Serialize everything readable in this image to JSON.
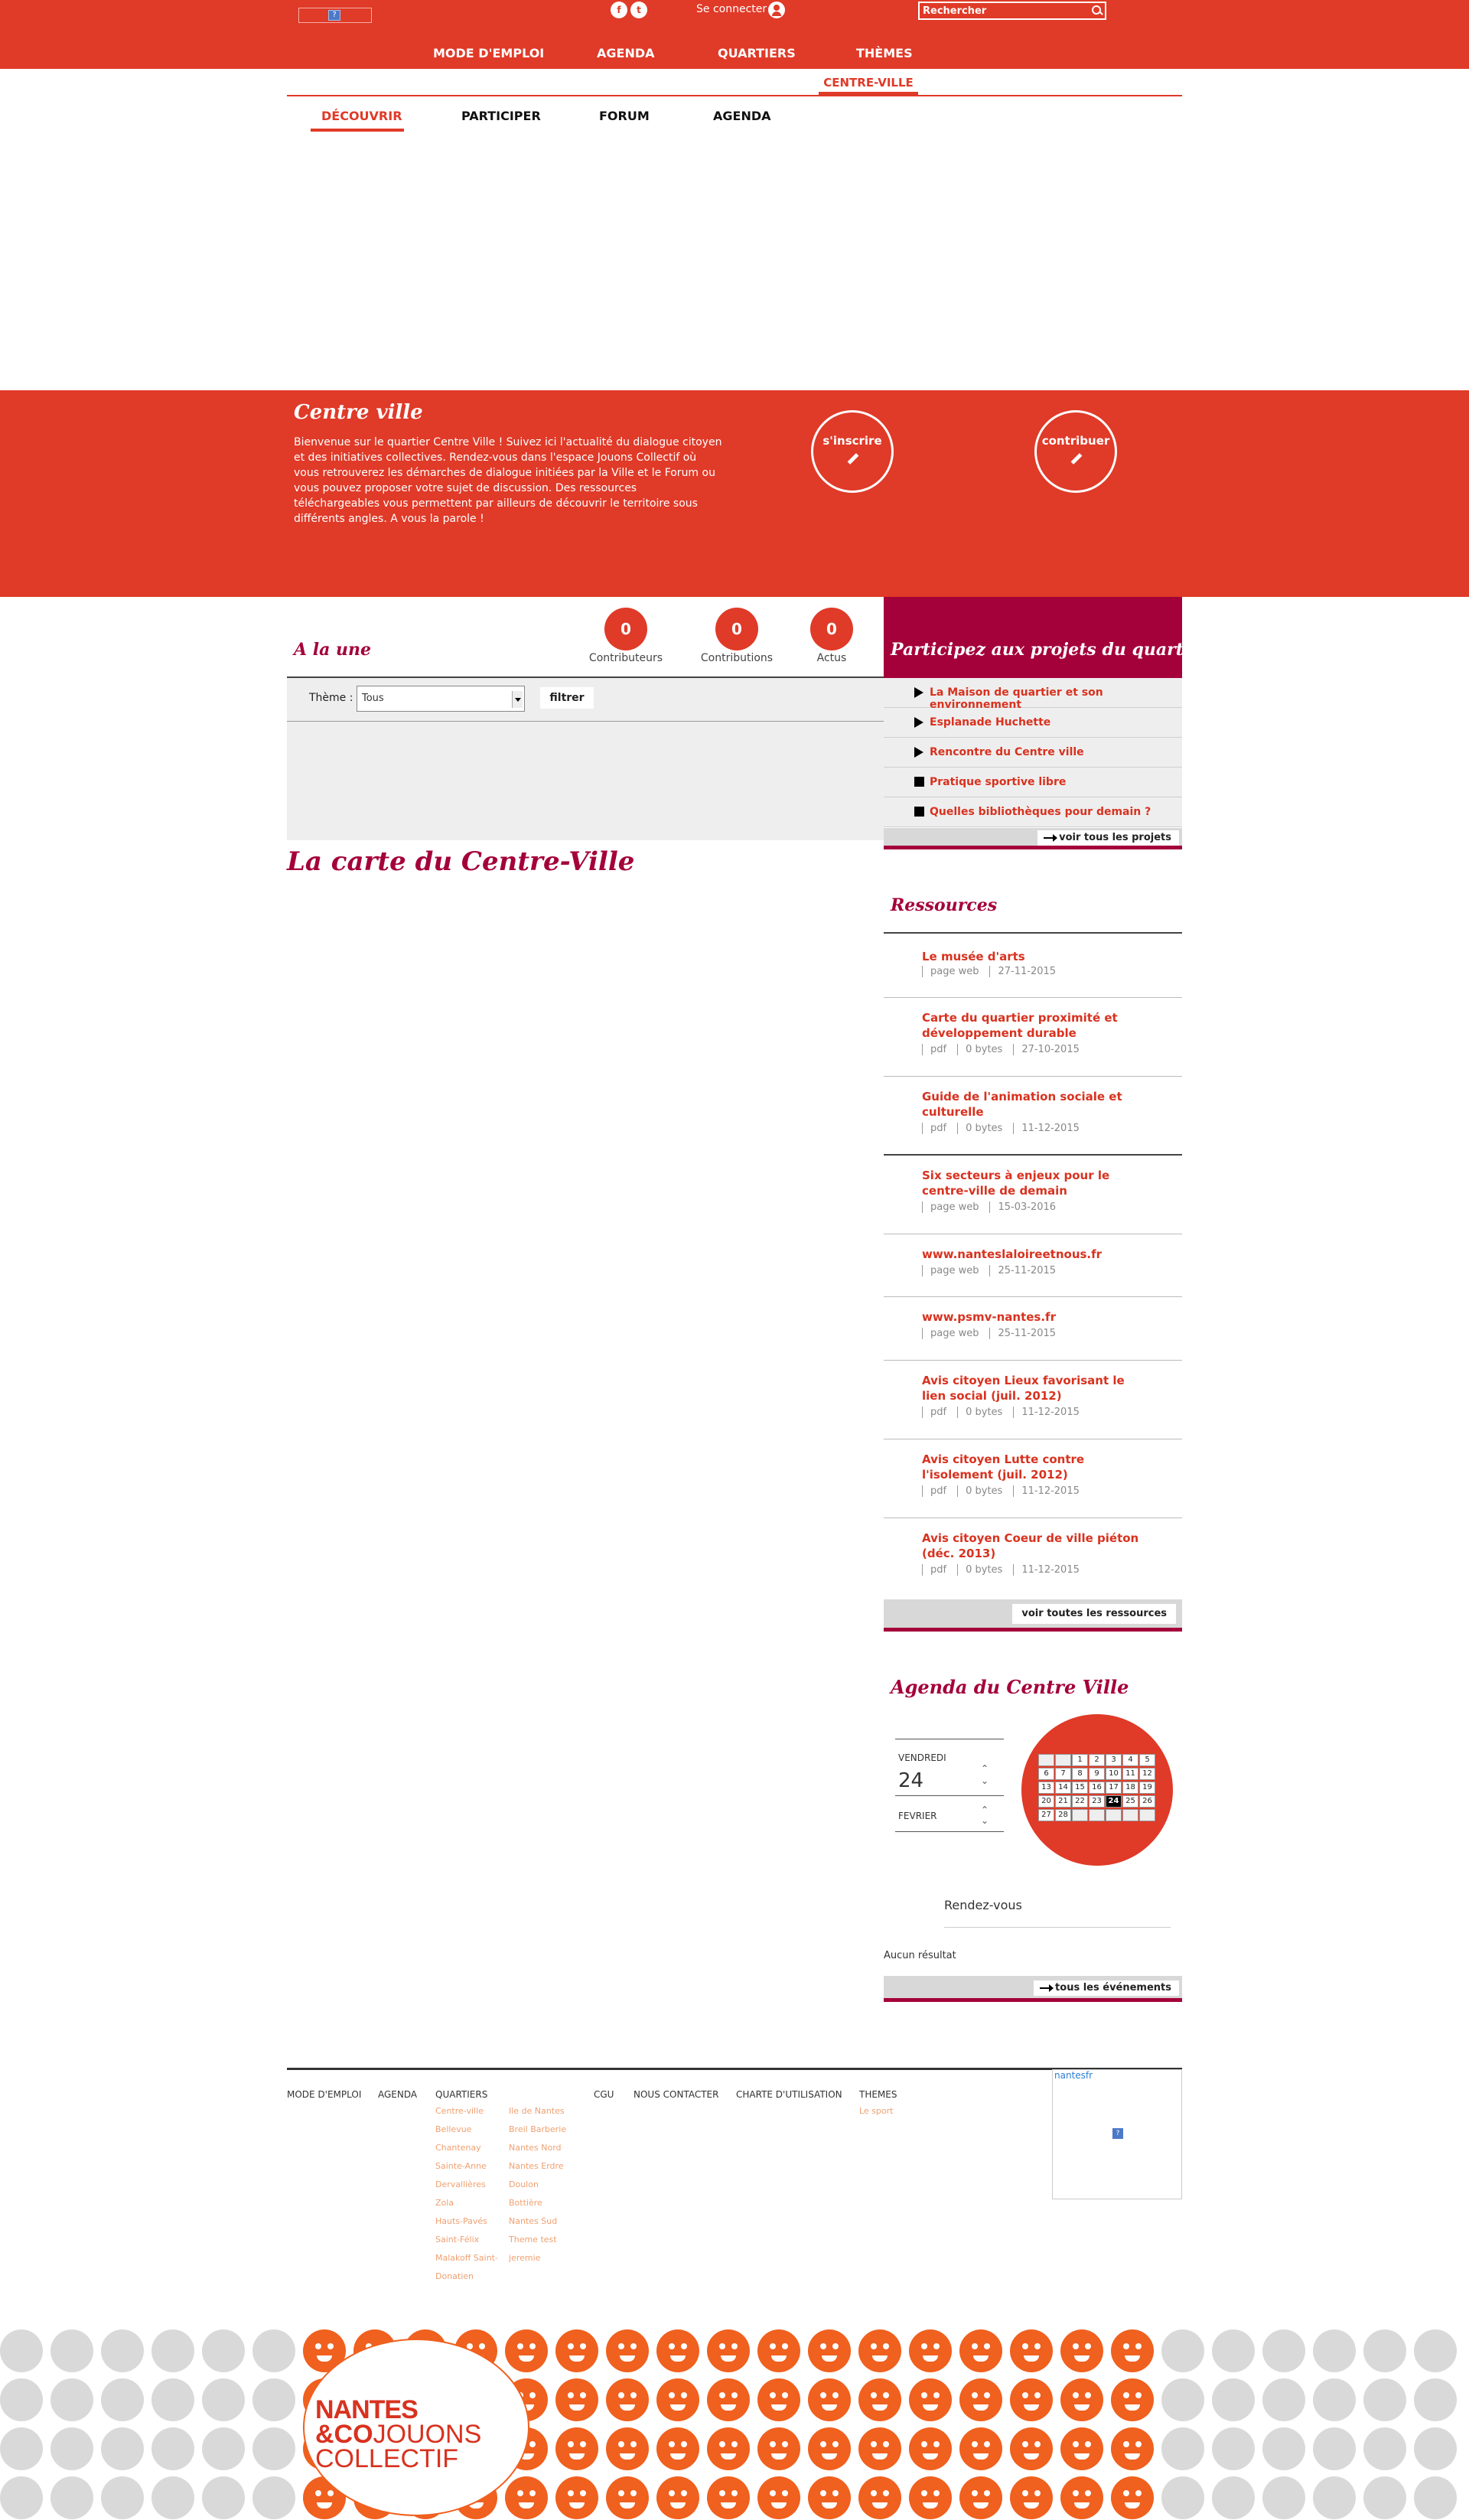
{
  "header": {
    "connect_label": "Se connecter",
    "social": [
      "f",
      "t"
    ],
    "search_placeholder": "Rechercher",
    "nav": [
      "MODE D'EMPLOI",
      "AGENDA",
      "QUARTIERS",
      "THÈMES"
    ]
  },
  "subheader": {
    "district_tab": "CENTRE-VILLE",
    "tabs": [
      "DÉCOUVRIR",
      "PARTICIPER",
      "FORUM",
      "AGENDA"
    ]
  },
  "banner": {
    "title": "Centre ville",
    "text": "Bienvenue sur le quartier Centre Ville ! Suivez ici l'actualité du dialogue citoyen et des initiatives collectives. Rendez-vous dans l'espace Jouons Collectif où vous retrouverez les démarches de dialogue initiées par la Ville et le Forum ou vous pouvez proposer votre sujet de discussion. Des ressources téléchargeables vous permettent par ailleurs de découvrir le territoire sous différents angles. A vous la parole !",
    "signup": "s'inscrire",
    "contribute": "contribuer"
  },
  "une": {
    "title": "A la une",
    "stats": [
      {
        "value": "0",
        "label": "Contributeurs"
      },
      {
        "value": "0",
        "label": "Contributions"
      },
      {
        "value": "0",
        "label": "Actus"
      }
    ],
    "theme_label": "Thème :",
    "theme_value": "Tous",
    "filter_button": "filtrer"
  },
  "map_title": "La carte du Centre-Ville",
  "projects": {
    "title": "Participez aux projets du quartier",
    "items": [
      {
        "label": "La Maison de quartier et son environnement",
        "marker": "triangle"
      },
      {
        "label": "Esplanade Huchette",
        "marker": "triangle"
      },
      {
        "label": "Rencontre du Centre ville",
        "marker": "triangle"
      },
      {
        "label": "Pratique sportive libre",
        "marker": "square"
      },
      {
        "label": "Quelles bibliothèques pour demain ?",
        "marker": "square"
      }
    ],
    "all_label": "voir tous les projets"
  },
  "resources": {
    "title": "Ressources",
    "items": [
      {
        "title": "Le musée d'arts",
        "meta": [
          "page web",
          "27-11-2015"
        ]
      },
      {
        "title": "Carte du quartier proximité et développement durable",
        "meta": [
          "pdf",
          "0 bytes",
          "27-10-2015"
        ]
      },
      {
        "title": "Guide de l'animation sociale et culturelle",
        "meta": [
          "pdf",
          "0 bytes",
          "11-12-2015"
        ]
      },
      {
        "title": "Six secteurs à enjeux pour le centre-ville de demain",
        "meta": [
          "page web",
          "15-03-2016"
        ]
      },
      {
        "title": "www.nanteslaloireetnous.fr",
        "meta": [
          "page web",
          "25-11-2015"
        ]
      },
      {
        "title": "www.psmv-nantes.fr",
        "meta": [
          "page web",
          "25-11-2015"
        ]
      },
      {
        "title": "Avis citoyen Lieux favorisant le lien social (juil. 2012)",
        "meta": [
          "pdf",
          "0 bytes",
          "11-12-2015"
        ]
      },
      {
        "title": "Avis citoyen Lutte contre l'isolement (juil. 2012)",
        "meta": [
          "pdf",
          "0 bytes",
          "11-12-2015"
        ]
      },
      {
        "title": "Avis citoyen Coeur de ville piéton (déc. 2013)",
        "meta": [
          "pdf",
          "0 bytes",
          "11-12-2015"
        ]
      }
    ],
    "all_label": "voir toutes les ressources"
  },
  "agenda": {
    "title": "Agenda du Centre Ville",
    "weekday": "VENDREDI",
    "day": "24",
    "month": "FEVRIER",
    "calendar": [
      [
        "",
        "",
        "1",
        "2",
        "3",
        "4",
        "5"
      ],
      [
        "6",
        "7",
        "8",
        "9",
        "10",
        "11",
        "12"
      ],
      [
        "13",
        "14",
        "15",
        "16",
        "17",
        "18",
        "19"
      ],
      [
        "20",
        "21",
        "22",
        "23",
        "24",
        "25",
        "26"
      ],
      [
        "27",
        "28",
        "",
        "",
        "",
        "",
        ""
      ]
    ],
    "selected_day": "24",
    "rdv_title": "Rendez-vous",
    "no_result": "Aucun résultat",
    "all_label": "tous les événements"
  },
  "footer": {
    "nav": [
      "MODE D'EMPLOI",
      "AGENDA",
      "QUARTIERS",
      "CGU",
      "NOUS CONTACTER",
      "CHARTE D'UTILISATION",
      "THEMES"
    ],
    "quartiers_col1": [
      "Centre-ville",
      "Bellevue",
      "Chantenay",
      "Sainte-Anne",
      "Dervallières",
      "Zola",
      "Hauts-Pavés",
      "Saint-Félix",
      "Malakoff Saint-",
      "Donatien"
    ],
    "quartiers_col2": [
      "Ile de Nantes",
      "Breil Barberie",
      "Nantes Nord",
      "Nantes Erdre",
      "Doulon",
      "Bottière",
      "Nantes Sud",
      "Theme test",
      "jeremie"
    ],
    "themes": [
      "Le sport"
    ],
    "twitter_name": "nantesfr"
  },
  "brand": {
    "line1": "NANTES",
    "line2a": "&CO",
    "line2b": "JOUONS",
    "line3": "COLLECTIF"
  }
}
